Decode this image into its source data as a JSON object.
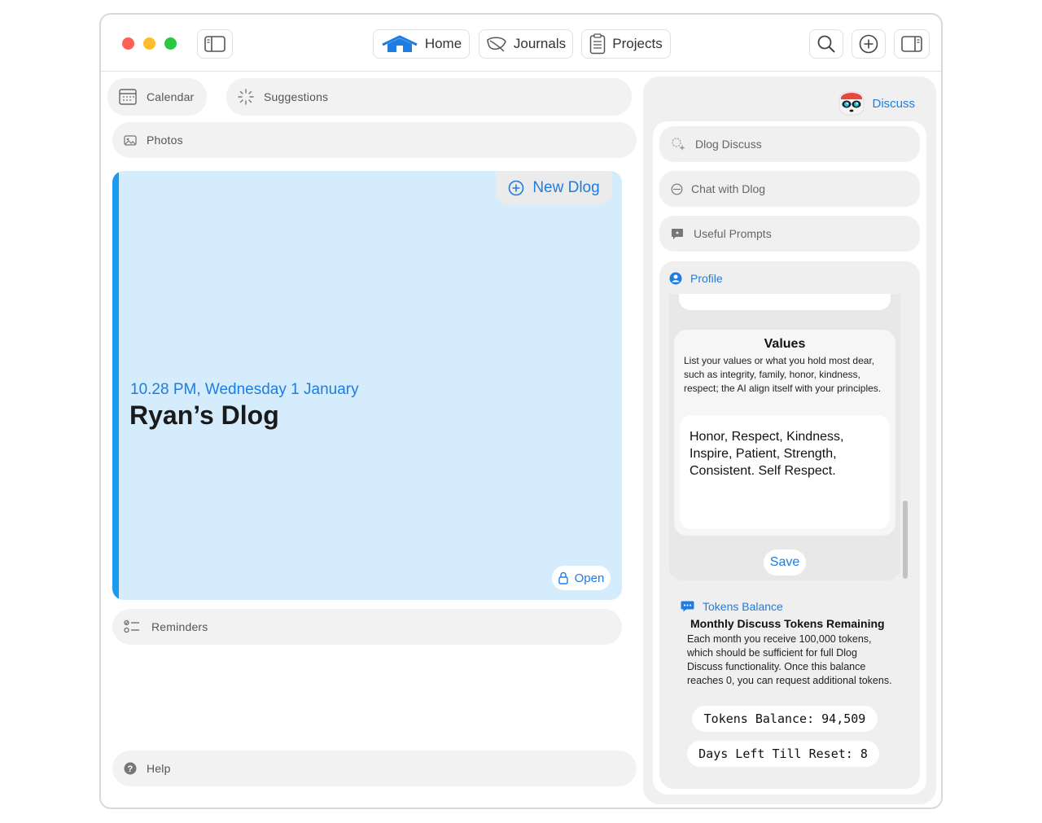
{
  "toolbar": {
    "home_label": "Home",
    "journals_label": "Journals",
    "projects_label": "Projects"
  },
  "left": {
    "calendar_label": "Calendar",
    "suggestions_label": "Suggestions",
    "photos_label": "Photos",
    "reminders_label": "Reminders",
    "help_label": "Help"
  },
  "dlog": {
    "new_label": "New Dlog",
    "date": "10.28 PM, Wednesday 1 January",
    "title": "Ryan’s Dlog",
    "open_label": "Open"
  },
  "discuss": {
    "header_label": "Discuss",
    "menu": {
      "dlog_discuss": "Dlog Discuss",
      "chat": "Chat with Dlog",
      "prompts": "Useful Prompts"
    },
    "profile": {
      "label": "Profile",
      "values_title": "Values",
      "values_desc": "List your values or what you hold most dear, such as integrity, family, honor, kindness, respect; the AI align itself with your principles.",
      "values_text": "Honor, Respect, Kindness, Inspire, Patient, Strength, Consistent. Self Respect.",
      "save_label": "Save"
    },
    "tokens": {
      "label": "Tokens Balance",
      "subtitle": "Monthly Discuss Tokens Remaining",
      "desc": "Each month you receive 100,000 tokens, which should be sufficient for full Dlog Discuss functionality. Once this balance reaches 0, you can request additional tokens.",
      "balance_text": "Tokens Balance: 94,509",
      "days_text": "Days Left Till Reset: 8"
    }
  },
  "colors": {
    "accent": "#1f7ce0",
    "dlog_card_bg": "#d4ecfb",
    "dlog_card_bar": "#1a9bf0",
    "traffic_red": "#fe5f57",
    "traffic_yellow": "#febc2e",
    "traffic_green": "#28c840"
  },
  "icons": {
    "sidebar_toggle": "sidebar-left-icon",
    "home": "house-icon",
    "journals": "leaf-icon",
    "projects": "clipboard-icon",
    "search": "search-icon",
    "add": "plus-circle-icon",
    "inspector": "sidebar-right-icon"
  }
}
